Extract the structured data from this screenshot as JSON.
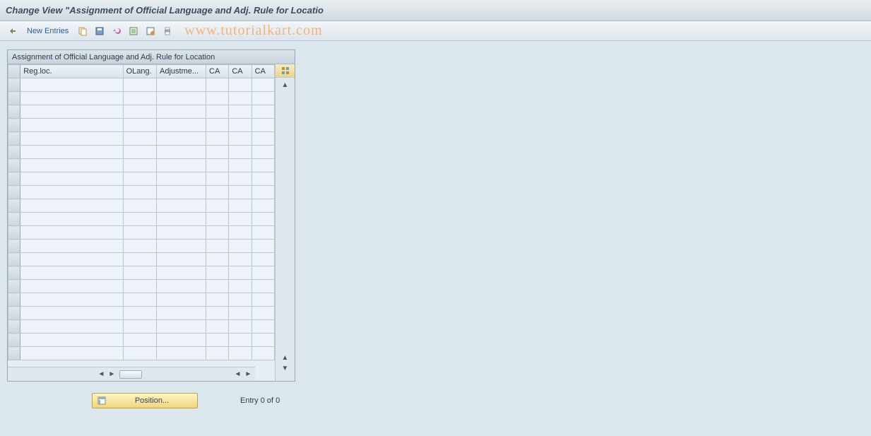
{
  "header": {
    "title": "Change View \"Assignment of Official Language and Adj. Rule for Locatio"
  },
  "toolbar": {
    "new_entries_label": "New Entries",
    "watermark_text": "www.tutorialkart.com"
  },
  "panel": {
    "title": "Assignment of Official Language and Adj. Rule for Location",
    "columns": {
      "regloc": "Reg.loc.",
      "olang": "OLang.",
      "adjustment": "Adjustme...",
      "ca1": "CA",
      "ca2": "CA",
      "ca3": "CA"
    }
  },
  "footer": {
    "position_label": "Position...",
    "entry_text": "Entry 0 of 0"
  }
}
